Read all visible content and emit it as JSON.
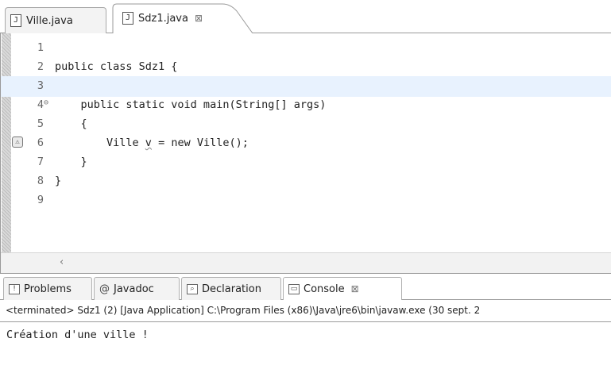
{
  "editor": {
    "tabs": [
      {
        "label": "Ville.java",
        "icon": "java-file-icon",
        "active": false
      },
      {
        "label": "Sdz1.java",
        "icon": "java-file-icon",
        "active": true,
        "close": "⊠"
      }
    ],
    "lines": [
      {
        "num": "1",
        "code": ""
      },
      {
        "num": "2",
        "code": "public class Sdz1 {"
      },
      {
        "num": "3",
        "code": ""
      },
      {
        "num": "4",
        "code": "    public static void main(String[] args)",
        "fold": "⊖"
      },
      {
        "num": "5",
        "code": "    {"
      },
      {
        "num": "6",
        "code_before": "        Ville ",
        "code_warn": "v",
        "code_after": " = new Ville();",
        "marker": "warning-icon"
      },
      {
        "num": "7",
        "code": "    }"
      },
      {
        "num": "8",
        "code": "}"
      },
      {
        "num": "9",
        "code": ""
      }
    ],
    "scroll_left": "‹"
  },
  "panel": {
    "tabs": [
      {
        "label": "Problems",
        "icon": "problems-icon"
      },
      {
        "label": "Javadoc",
        "icon": "at-icon",
        "glyph": "@"
      },
      {
        "label": "Declaration",
        "icon": "declaration-icon"
      },
      {
        "label": "Console",
        "icon": "console-icon",
        "active": true,
        "close": "⊠"
      }
    ],
    "status": "<terminated> Sdz1 (2) [Java Application] C:\\Program Files (x86)\\Java\\jre6\\bin\\javaw.exe (30 sept. 2",
    "output": "Création d'une ville !"
  }
}
